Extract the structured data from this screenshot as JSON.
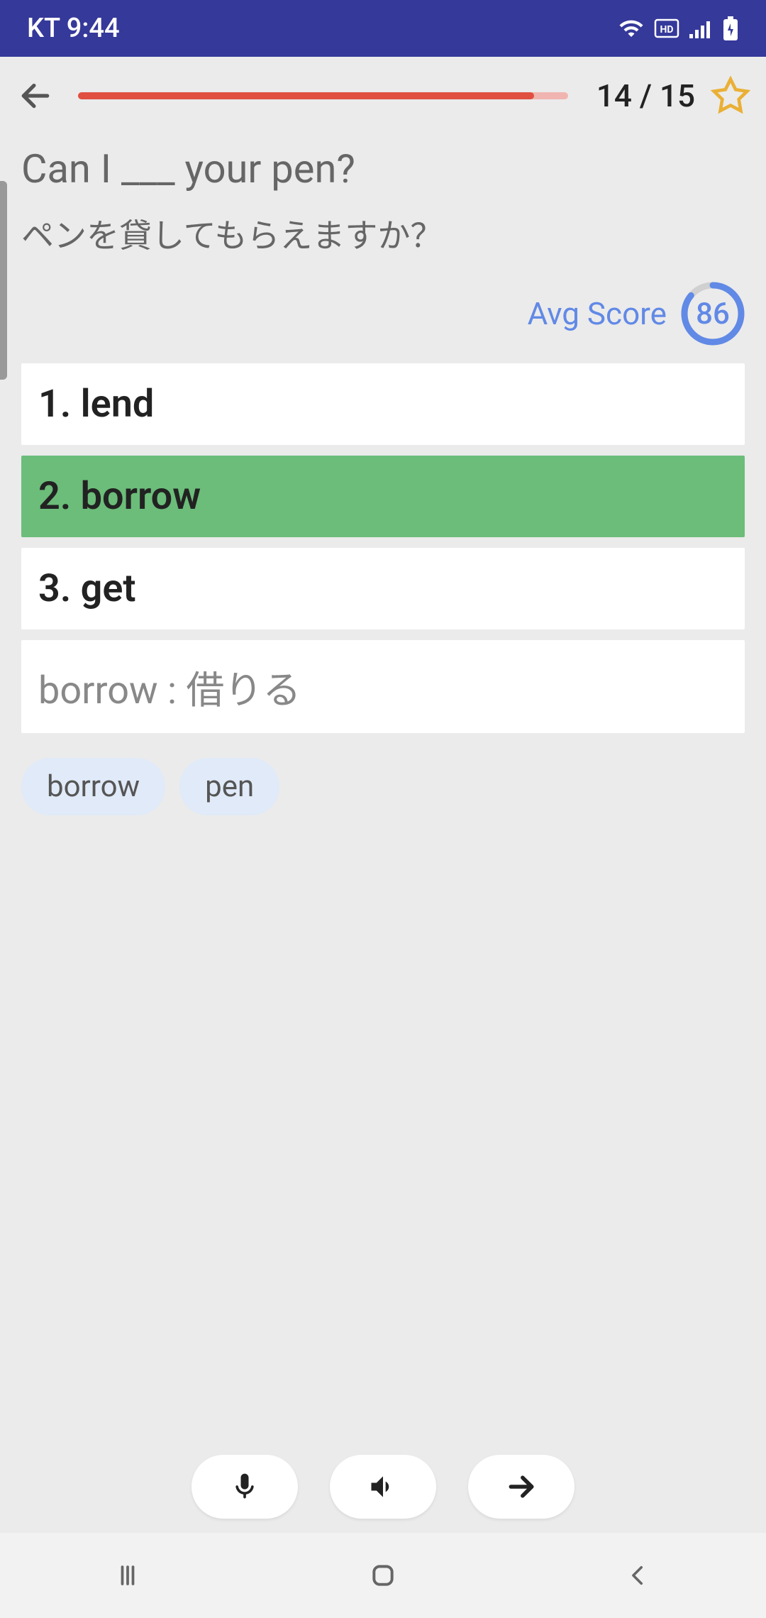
{
  "status": {
    "carrier_time": "KT 9:44"
  },
  "header": {
    "progress_current": 14,
    "progress_total": 15,
    "progress_text": "14 / 15",
    "progress_pct": 93
  },
  "question": {
    "english": "Can I ___ your pen?",
    "japanese": "ペンを貸してもらえますか？"
  },
  "score": {
    "label": "Avg Score",
    "value": "86",
    "percent": 86
  },
  "options": [
    {
      "num": "1.",
      "text": "lend",
      "selected": false
    },
    {
      "num": "2.",
      "text": "borrow",
      "selected": true
    },
    {
      "num": "3.",
      "text": "get",
      "selected": false
    }
  ],
  "definition": "borrow : 借りる",
  "chips": [
    "borrow",
    "pen"
  ]
}
